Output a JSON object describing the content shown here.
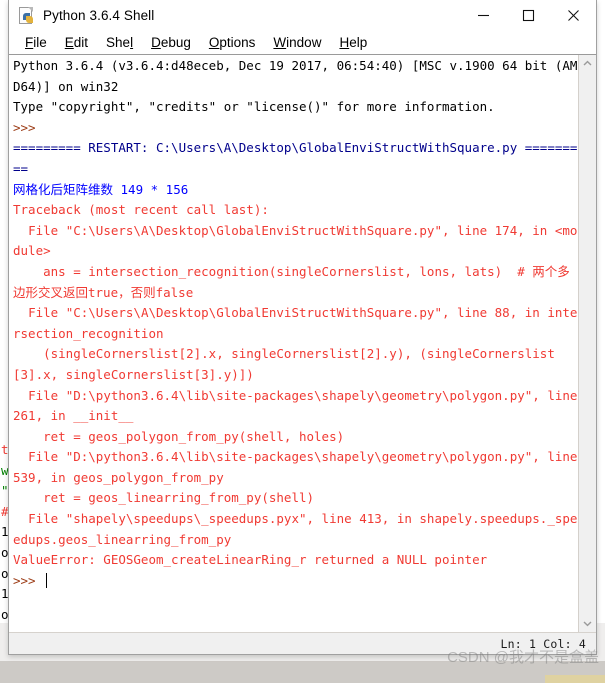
{
  "window": {
    "title": "Python 3.6.4 Shell",
    "icon": "python-file-icon",
    "controls": {
      "minimize": "minimize-button",
      "maximize": "maximize-button",
      "close": "close-button"
    }
  },
  "menubar": {
    "items": [
      {
        "label": "File",
        "pre": "F",
        "key": "F",
        "post": "ile"
      },
      {
        "label": "Edit",
        "pre": "E",
        "key": "E",
        "post": "dit"
      },
      {
        "label": "Shell",
        "pre": "Shel",
        "key": "l",
        "post": ""
      },
      {
        "label": "Debug",
        "pre": "D",
        "key": "D",
        "post": "ebug"
      },
      {
        "label": "Options",
        "pre": "O",
        "key": "O",
        "post": "ptions"
      },
      {
        "label": "Window",
        "pre": "W",
        "key": "W",
        "post": "indow"
      },
      {
        "label": "Help",
        "pre": "H",
        "key": "H",
        "post": "elp"
      }
    ]
  },
  "console": {
    "lines": [
      {
        "color": "black",
        "text": "Python 3.6.4 (v3.6.4:d48eceb, Dec 19 2017, 06:54:40) [MSC v.1900 64 bit (AMD64)] on win32"
      },
      {
        "color": "black",
        "text": "Type \"copyright\", \"credits\" or \"license()\" for more information."
      },
      {
        "color": "prompt",
        "text": ">>> "
      },
      {
        "color": "navy",
        "text": "========= RESTART: C:\\Users\\A\\Desktop\\GlobalEnviStructWithSquare.py ========="
      },
      {
        "color": "blue",
        "text": "网格化后矩阵维数 149 * 156"
      },
      {
        "color": "red",
        "text": "Traceback (most recent call last):"
      },
      {
        "color": "red",
        "text": "  File \"C:\\Users\\A\\Desktop\\GlobalEnviStructWithSquare.py\", line 174, in <module>"
      },
      {
        "color": "red",
        "text": "    ans = intersection_recognition(singleCornerslist, lons, lats)  # 两个多边形交叉返回true，否则false"
      },
      {
        "color": "red",
        "text": "  File \"C:\\Users\\A\\Desktop\\GlobalEnviStructWithSquare.py\", line 88, in intersection_recognition"
      },
      {
        "color": "red",
        "text": "    (singleCornerslist[2].x, singleCornerslist[2].y), (singleCornerslist[3].x, singleCornerslist[3].y)])"
      },
      {
        "color": "red",
        "text": "  File \"D:\\python3.6.4\\lib\\site-packages\\shapely\\geometry\\polygon.py\", line 261, in __init__"
      },
      {
        "color": "red",
        "text": "    ret = geos_polygon_from_py(shell, holes)"
      },
      {
        "color": "red",
        "text": "  File \"D:\\python3.6.4\\lib\\site-packages\\shapely\\geometry\\polygon.py\", line 539, in geos_polygon_from_py"
      },
      {
        "color": "red",
        "text": "    ret = geos_linearring_from_py(shell)"
      },
      {
        "color": "red",
        "text": "  File \"shapely\\speedups\\_speedups.pyx\", line 413, in shapely.speedups._speedups.geos_linearring_from_py"
      },
      {
        "color": "red",
        "text": "ValueError: GEOSGeom_createLinearRing_r returned a NULL pointer"
      },
      {
        "color": "prompt",
        "text": ">>> "
      }
    ]
  },
  "scrollbar": {
    "up_arrow": "scroll-up-arrow",
    "down_arrow": "scroll-down-arrow"
  },
  "statusbar": {
    "position": "Ln: 1  Col: 4"
  },
  "watermark": {
    "text": "CSDN @我才不是盒盖"
  },
  "background_window": {
    "edge_chars": [
      {
        "text": "t",
        "color": "#f03a33"
      },
      {
        "text": "w",
        "color": "#008000"
      },
      {
        "text": "\"",
        "color": "#008000"
      },
      {
        "text": "#",
        "color": "#f03a33"
      },
      {
        "text": "1",
        "color": "#000000"
      },
      {
        "text": "o",
        "color": "#000000"
      },
      {
        "text": "o",
        "color": "#000000"
      },
      {
        "text": "1",
        "color": "#000000"
      },
      {
        "text": "o",
        "color": "#000000"
      },
      {
        "text": "o",
        "color": "#000000"
      }
    ]
  },
  "colors": {
    "error_red": "#f03a33",
    "prompt_brown": "#9c3b15",
    "restart_navy": "#00008b",
    "output_blue": "#0000ff",
    "window_chrome": "#ffffff",
    "statusbar_bg": "#f0f0f0"
  }
}
